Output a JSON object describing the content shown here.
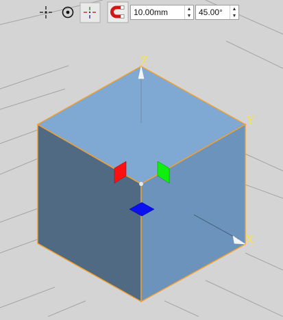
{
  "toolbar": {
    "tools": [
      {
        "icon": "move-crosshair-icon",
        "active": false
      },
      {
        "icon": "rotate-target-icon",
        "active": false
      },
      {
        "icon": "scale-axes-icon",
        "active": true
      },
      {
        "icon": "magnet-snap-icon",
        "active": true
      }
    ],
    "distance_value": "10.00mm",
    "angle_value": "45.00°",
    "spin_up": "▲",
    "spin_down": "▼"
  },
  "viewport": {
    "axis_labels": {
      "z": "Z",
      "y": "Y",
      "x": "X"
    },
    "colors": {
      "background": "#d4d4d4",
      "grid": "#9e9e9e",
      "cube_top": "#7fa9d2",
      "cube_left": "#4f6a82",
      "cube_right": "#6c93bb",
      "cube_edge": "#f0a030",
      "handle_red": "#ff1010",
      "handle_green": "#10ee10",
      "handle_blue": "#0a10f0",
      "axis_label": "#f5e641"
    }
  }
}
